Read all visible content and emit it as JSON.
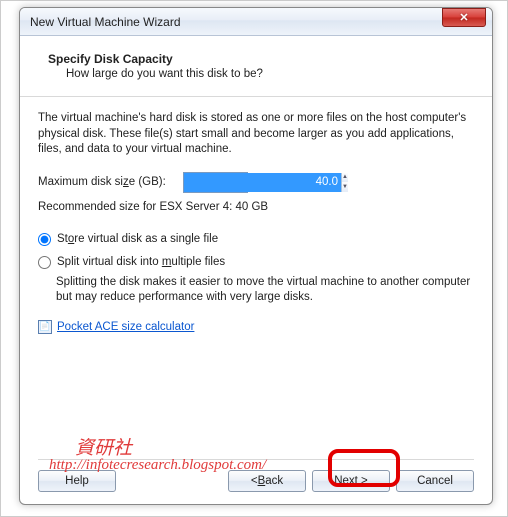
{
  "window": {
    "title": "New Virtual Machine Wizard",
    "close_glyph": "✕"
  },
  "header": {
    "title": "Specify Disk Capacity",
    "subtitle": "How large do you want this disk to be?"
  },
  "body": {
    "intro": "The virtual machine's hard disk is stored as one or more files on the host computer's physical disk. These file(s) start small and become larger as you add applications, files, and data to your virtual machine.",
    "max_label_pre": "Maximum disk si",
    "max_label_u": "z",
    "max_label_post": "e (GB):",
    "max_value": "40.0",
    "recommended": "Recommended size for ESX Server 4: 40 GB"
  },
  "options": {
    "single_pre": "St",
    "single_u": "o",
    "single_post": "re virtual disk as a single file",
    "split_pre": "Split virtual disk into ",
    "split_u": "m",
    "split_post": "ultiple files",
    "split_desc": "Splitting the disk makes it easier to move the virtual machine to another computer but may reduce performance with very large disks."
  },
  "link": {
    "label": "Pocket ACE size calculator"
  },
  "buttons": {
    "help": "Help",
    "back_pre": "< ",
    "back_u": "B",
    "back_post": "ack",
    "next_pre": "",
    "next_u": "N",
    "next_post": "ext >",
    "cancel": "Cancel"
  },
  "watermark": {
    "line1": "資研社",
    "line2": "http://infotecresearch.blogspot.com/"
  }
}
